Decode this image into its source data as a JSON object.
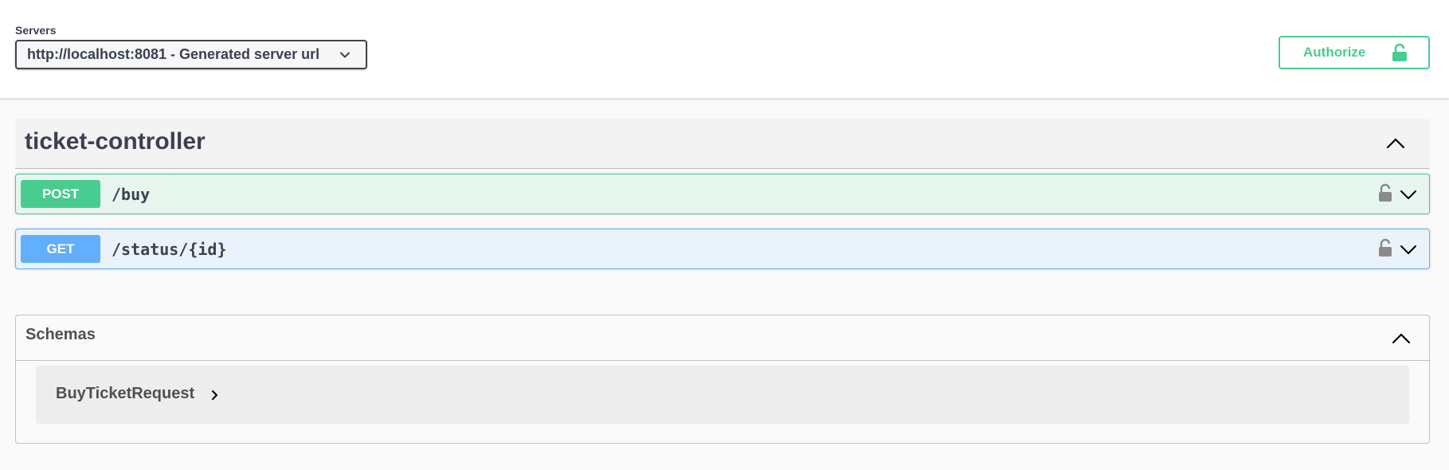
{
  "servers": {
    "title": "Servers",
    "selected": "http://localhost:8081 - Generated server url"
  },
  "authorize": {
    "label": "Authorize",
    "icon": "unlocked-lock-icon"
  },
  "tag": {
    "name": "ticket-controller",
    "expanded": true
  },
  "operations": [
    {
      "method": "POST",
      "path": "/buy",
      "color": "#49cc90"
    },
    {
      "method": "GET",
      "path": "/status/{id}",
      "color": "#61affe"
    }
  ],
  "schemas": {
    "title": "Schemas",
    "models": [
      {
        "name": "BuyTicketRequest"
      }
    ]
  },
  "colors": {
    "post": "#49cc90",
    "get": "#61affe",
    "text": "#3b4151"
  }
}
